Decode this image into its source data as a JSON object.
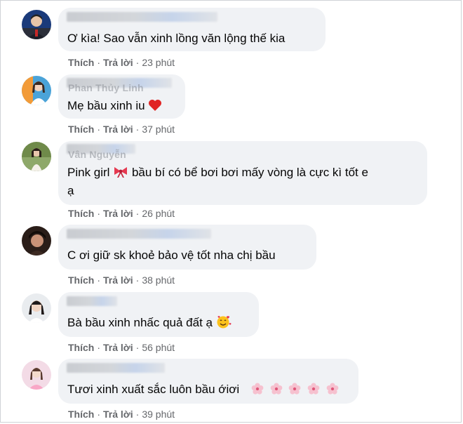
{
  "labels": {
    "like": "Thích",
    "reply": "Trả lời",
    "separator": "·"
  },
  "comments": [
    {
      "text": "Ơ kìa! Sao vẫn xinh lồng văn lộng thế kia",
      "time": "23 phút",
      "emoji": ""
    },
    {
      "name_partial": "Phan Thủy Linh",
      "text": "Mẹ bầu xinh iu",
      "time": "37 phút",
      "emoji": "red-heart"
    },
    {
      "name_partial": "Vân Nguyễn",
      "text_line1": "Pink girl",
      "text_line1_rest": "bầu bí có bể bơi bơi mấy vòng là cực kì tốt e",
      "text_line2": "ạ",
      "time": "26 phút",
      "emoji": "ribbon"
    },
    {
      "text": "C ơi giữ sk khoẻ bảo vệ tốt nha chị bầu",
      "time": "38 phút",
      "emoji": ""
    },
    {
      "text": "Bà bầu xinh nhấc quả đất ạ",
      "time": "56 phút",
      "emoji": "smiling-face-with-hearts"
    },
    {
      "text": "Tươi xinh xuất sắc luôn bầu ớiơi",
      "time": "39 phút",
      "emoji": "cherry-blossom-x5"
    }
  ],
  "colors": {
    "bubble": "#f0f2f5",
    "text": "#050505",
    "meta": "#65676b"
  }
}
